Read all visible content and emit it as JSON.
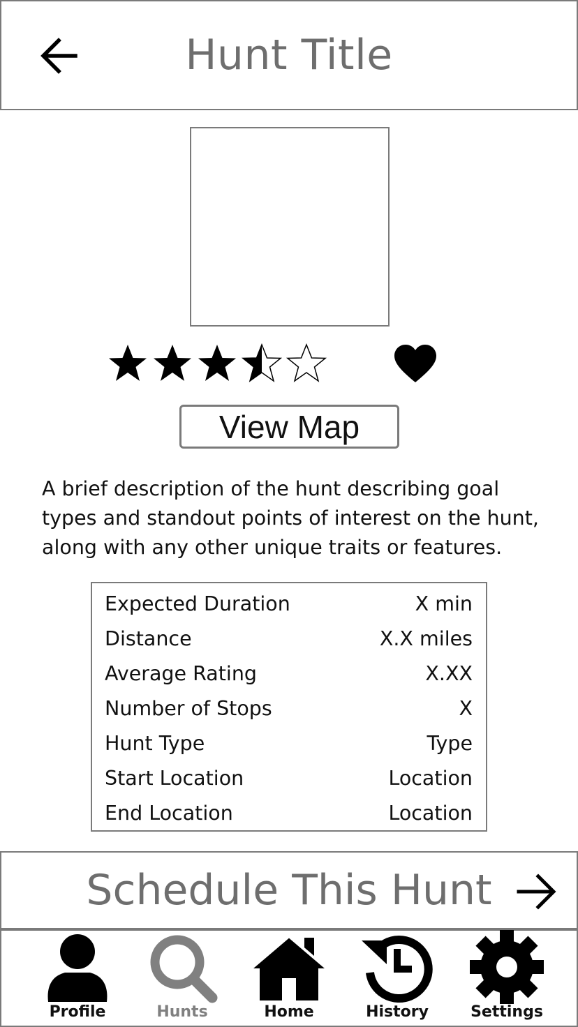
{
  "header": {
    "title": "Hunt Title"
  },
  "rating": {
    "stars": 3.5,
    "max": 5
  },
  "actions": {
    "view_map_label": "View Map"
  },
  "description": "A brief description of the hunt describing goal types and standout points of interest on the hunt, along with any other unique traits or features.",
  "stats": [
    {
      "label": "Expected Duration",
      "value": "X min"
    },
    {
      "label": "Distance",
      "value": "X.X miles"
    },
    {
      "label": "Average Rating",
      "value": "X.XX"
    },
    {
      "label": "Number of Stops",
      "value": "X"
    },
    {
      "label": "Hunt Type",
      "value": "Type"
    },
    {
      "label": "Start Location",
      "value": "Location"
    },
    {
      "label": "End Location",
      "value": "Location"
    }
  ],
  "schedule": {
    "label": "Schedule This Hunt"
  },
  "nav": {
    "items": [
      {
        "label": "Profile",
        "icon": "person-icon",
        "active": false
      },
      {
        "label": "Hunts",
        "icon": "search-icon",
        "active": true
      },
      {
        "label": "Home",
        "icon": "home-icon",
        "active": false
      },
      {
        "label": "History",
        "icon": "history-icon",
        "active": false
      },
      {
        "label": "Settings",
        "icon": "gear-icon",
        "active": false
      }
    ]
  },
  "colors": {
    "border": "#7a7a7a",
    "title_text": "#6e6e6e",
    "active_nav": "#808080",
    "icon": "#000000"
  }
}
